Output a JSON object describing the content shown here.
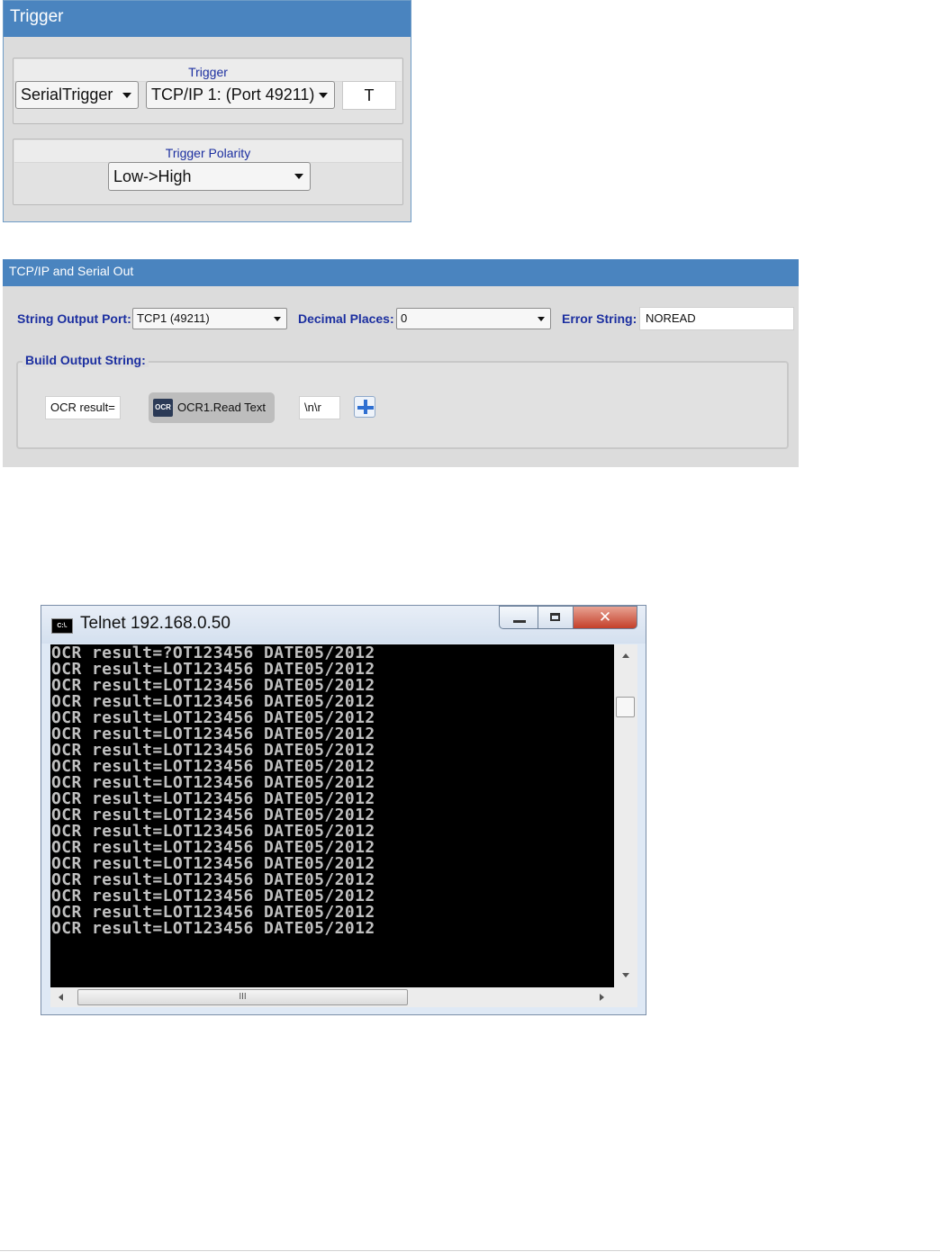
{
  "trigger_panel": {
    "title": "Trigger",
    "group_trigger_label": "Trigger",
    "trigger_type": "SerialTrigger",
    "trigger_port": "TCP/IP 1: (Port 49211)",
    "trigger_char": "T",
    "group_polarity_label": "Trigger Polarity",
    "polarity": "Low->High"
  },
  "tcp_panel": {
    "title": "TCP/IP and Serial Out",
    "string_output_port_label": "String Output Port:",
    "string_output_port": "TCP1 (49211)",
    "decimal_places_label": "Decimal Places:",
    "decimal_places": "0",
    "error_string_label": "Error String:",
    "error_string": "NOREAD",
    "build_output_label": "Build Output String:",
    "tokens": {
      "prefix": "OCR result=",
      "ocr_icon_text": "OCR",
      "ocr_field": "OCR1.Read Text",
      "suffix": "\\n\\r"
    }
  },
  "telnet": {
    "title": "Telnet 192.168.0.50",
    "icon_text": "C:\\.",
    "lines": [
      "OCR result=?OT123456 DATE05/2012",
      "OCR result=LOT123456 DATE05/2012",
      "OCR result=LOT123456 DATE05/2012",
      "OCR result=LOT123456 DATE05/2012",
      "OCR result=LOT123456 DATE05/2012",
      "OCR result=LOT123456 DATE05/2012",
      "OCR result=LOT123456 DATE05/2012",
      "OCR result=LOT123456 DATE05/2012",
      "OCR result=LOT123456 DATE05/2012",
      "OCR result=LOT123456 DATE05/2012",
      "OCR result=LOT123456 DATE05/2012",
      "OCR result=LOT123456 DATE05/2012",
      "OCR result=LOT123456 DATE05/2012",
      "OCR result=LOT123456 DATE05/2012",
      "OCR result=LOT123456 DATE05/2012",
      "OCR result=LOT123456 DATE05/2012",
      "OCR result=LOT123456 DATE05/2012",
      "OCR result=LOT123456 DATE05/2012"
    ],
    "hscroll_grip": "III"
  }
}
